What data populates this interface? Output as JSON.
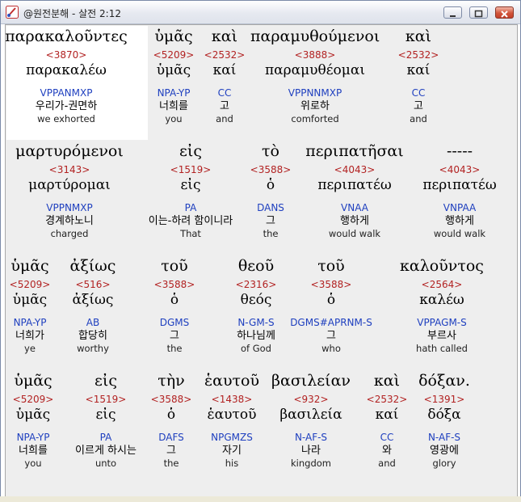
{
  "window": {
    "title": "@원전분해 - 살전 2:12",
    "icon": "app-brush-icon",
    "buttons": {
      "minimize": "minimize-icon",
      "maximize": "maximize-icon",
      "close": "close-icon"
    }
  },
  "rows": [
    [
      {
        "greek": "παρακαλοῦντες",
        "strong": "<3870>",
        "lemma": "παρακαλέω",
        "parse": "VPPANMXP",
        "korean": "우리가-권면하",
        "english": "we exhorted"
      },
      {
        "greek": "ὑμᾶς",
        "strong": "<5209>",
        "lemma": "ὑμᾶς",
        "parse": "NPA-YP",
        "korean": "너희를",
        "english": "you"
      },
      {
        "greek": "καὶ",
        "strong": "<2532>",
        "lemma": "καί",
        "parse": "CC",
        "korean": "고",
        "english": "and"
      },
      {
        "greek": "παραμυθούμενοι",
        "strong": "<3888>",
        "lemma": "παραμυθέομαι",
        "parse": "VPPNNMXP",
        "korean": "위로하",
        "english": "comforted"
      },
      {
        "greek": "καὶ",
        "strong": "<2532>",
        "lemma": "καί",
        "parse": "CC",
        "korean": "고",
        "english": "and"
      }
    ],
    [
      {
        "greek": "μαρτυρόμενοι",
        "strong": "<3143>",
        "lemma": "μαρτύρομαι",
        "parse": "VPPNMXP",
        "korean": "경계하노니",
        "english": "charged"
      },
      {
        "greek": "εἰς",
        "strong": "<1519>",
        "lemma": "εἰς",
        "parse": "PA",
        "korean": "이는-하려 함이니라",
        "english": "That"
      },
      {
        "greek": "τὸ",
        "strong": "<3588>",
        "lemma": "ὁ",
        "parse": "DANS",
        "korean": "그",
        "english": "the"
      },
      {
        "greek": "περιπατῆσαι",
        "strong": "<4043>",
        "lemma": "περιπατέω",
        "parse": "VNAA",
        "korean": "행하게",
        "english": "would walk"
      },
      {
        "greek": "-----",
        "strong": "<4043>",
        "lemma": "περιπατέω",
        "parse": "VNPAA",
        "korean": "행하게",
        "english": "would walk"
      }
    ],
    [
      {
        "greek": "ὑμᾶς",
        "strong": "<5209>",
        "lemma": "ὑμᾶς",
        "parse": "NPA-YP",
        "korean": "너희가",
        "english": "ye"
      },
      {
        "greek": "ἀξίως",
        "strong": "<516>",
        "lemma": "ἀξίως",
        "parse": "AB",
        "korean": "합당히",
        "english": "worthy"
      },
      {
        "greek": "τοῦ",
        "strong": "<3588>",
        "lemma": "ὁ",
        "parse": "DGMS",
        "korean": "그",
        "english": "the"
      },
      {
        "greek": "θεοῦ",
        "strong": "<2316>",
        "lemma": "θεός",
        "parse": "N-GM-S",
        "korean": "하나님께",
        "english": "of God"
      },
      {
        "greek": "τοῦ",
        "strong": "<3588>",
        "lemma": "ὁ",
        "parse": "DGMS#APRNM-S",
        "korean": "그",
        "english": "who"
      },
      {
        "greek": "καλοῦντος",
        "strong": "<2564>",
        "lemma": "καλέω",
        "parse": "VPPAGM-S",
        "korean": "부르사",
        "english": "hath called"
      }
    ],
    [
      {
        "greek": "ὑμᾶς",
        "strong": "<5209>",
        "lemma": "ὑμᾶς",
        "parse": "NPA-YP",
        "korean": "너희를",
        "english": "you"
      },
      {
        "greek": "εἰς",
        "strong": "<1519>",
        "lemma": "εἰς",
        "parse": "PA",
        "korean": "이르게 하시는",
        "english": "unto"
      },
      {
        "greek": "τὴν",
        "strong": "<3588>",
        "lemma": "ὁ",
        "parse": "DAFS",
        "korean": "그",
        "english": "the"
      },
      {
        "greek": "ἑαυτοῦ",
        "strong": "<1438>",
        "lemma": "ἑαυτοῦ",
        "parse": "NPGMZS",
        "korean": "자기",
        "english": "his"
      },
      {
        "greek": "βασιλείαν",
        "strong": "<932>",
        "lemma": "βασιλεία",
        "parse": "N-AF-S",
        "korean": "나라",
        "english": "kingdom"
      },
      {
        "greek": "καὶ",
        "strong": "<2532>",
        "lemma": "καί",
        "parse": "CC",
        "korean": "와",
        "english": "and"
      },
      {
        "greek": "δόξαν.",
        "strong": "<1391>",
        "lemma": "δόξα",
        "parse": "N-AF-S",
        "korean": "영광에",
        "english": "glory"
      }
    ]
  ],
  "colors": {
    "strong": "#b22222",
    "parse": "#1e3fbf",
    "background": "#eeeeee",
    "highlight": "#ffffff"
  }
}
